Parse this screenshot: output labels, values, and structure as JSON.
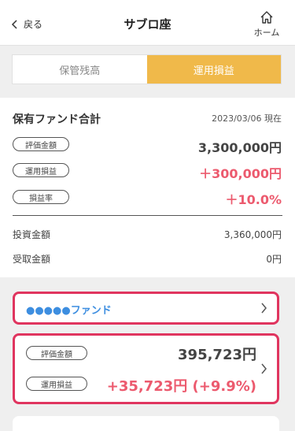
{
  "header": {
    "back_label": "戻る",
    "title": "サブロ座",
    "home_label": "ホーム"
  },
  "tabs": [
    {
      "label": "保管残高",
      "active": false
    },
    {
      "label": "運用損益",
      "active": true
    }
  ],
  "summary": {
    "title": "保有ファンド合計",
    "date": "2023/03/06 現在",
    "valuation_label": "評価金額",
    "valuation_value": "3,300,000円",
    "profit_label": "運用損益",
    "profit_value": "＋300,000円",
    "rate_label": "損益率",
    "rate_value": "＋10.0%",
    "invest_label": "投資金額",
    "invest_value": "3,360,000円",
    "received_label": "受取金額",
    "received_value": "0円"
  },
  "fund": {
    "name": "●●●●●ファンド",
    "valuation_label": "評価金額",
    "valuation_value": "395,723円",
    "profit_label": "運用損益",
    "profit_value": "+35,723円 (+9.9%)"
  },
  "colors": {
    "accent": "#f0b94a",
    "profit_red": "#ec5a6e",
    "highlight": "#e0355f",
    "fund_blue": "#3d8ee0"
  }
}
